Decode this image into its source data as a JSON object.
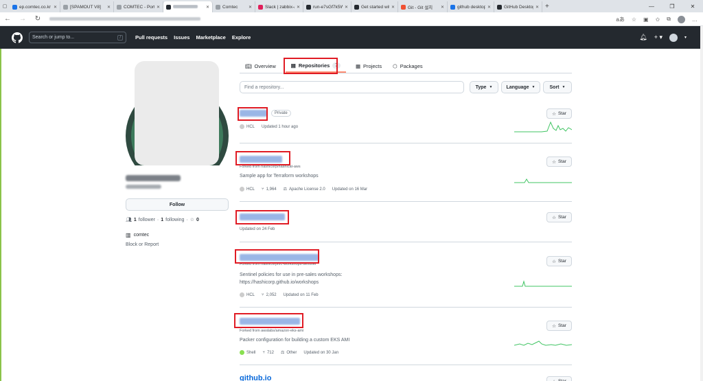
{
  "browser": {
    "tabs": [
      {
        "label": "",
        "color": "#5f6368",
        "icon": "window-icon"
      },
      {
        "label": "ep.comtec.co.kr",
        "color": "#1a73e8",
        "icon": "cloud-icon"
      },
      {
        "label": "[SPAMOUT V8]",
        "color": "#9aa0a6",
        "icon": "page-icon"
      },
      {
        "label": "COMTEC - Porta",
        "color": "#9aa0a6",
        "icon": "page-icon"
      },
      {
        "label": "",
        "color": "#24292f",
        "icon": "github-icon",
        "active": true
      },
      {
        "label": "Comtec",
        "color": "#9aa0a6",
        "icon": "page-icon"
      },
      {
        "label": "Slack | zabbix-a",
        "color": "#e01e5a",
        "icon": "slack-icon"
      },
      {
        "label": "run-e7sGf7k5W",
        "color": "#24292f",
        "icon": "fork-icon"
      },
      {
        "label": "Get started with",
        "color": "#24292f",
        "icon": "github-icon"
      },
      {
        "label": "Git - Git 설치",
        "color": "#f05133",
        "icon": "git-icon"
      },
      {
        "label": "github desktop",
        "color": "#1a73e8",
        "icon": "bing-icon"
      },
      {
        "label": "GitHub Desktop",
        "color": "#24292f",
        "icon": "github-icon"
      }
    ],
    "reader_label": "aあ"
  },
  "github": {
    "search_placeholder": "Search or jump to...",
    "search_key": "/",
    "nav": [
      "Pull requests",
      "Issues",
      "Marketplace",
      "Explore"
    ],
    "new_label": "+"
  },
  "profile": {
    "follow_label": "Follow",
    "followers_count": "1",
    "followers_label": "follower",
    "following_count": "1",
    "following_label": "following",
    "stars_count": "0",
    "org": "comtec",
    "block_label": "Block or Report"
  },
  "tabs": [
    {
      "label": "Overview",
      "icon": "book-icon"
    },
    {
      "label": "Repositories",
      "icon": "repo-icon",
      "count": "7",
      "selected": true
    },
    {
      "label": "Projects",
      "icon": "project-icon"
    },
    {
      "label": "Packages",
      "icon": "package-icon"
    }
  ],
  "filters": {
    "search_placeholder": "Find a repository...",
    "type_label": "Type",
    "language_label": "Language",
    "sort_label": "Sort"
  },
  "star_label": "Star",
  "repos": [
    {
      "badge": "Private",
      "forked": "",
      "description": "",
      "language": "HCL",
      "lang_color": "#cccccc",
      "forks": "",
      "license": "",
      "updated": "Updated 1 hour ago"
    },
    {
      "badge": "",
      "forked": "Forked from hashicorp/hashicat-aws",
      "description": "Sample app for Terraform workshops",
      "language": "HCL",
      "lang_color": "#cccccc",
      "forks": "1,964",
      "license": "Apache License 2.0",
      "updated": "Updated on 16 Mar"
    },
    {
      "badge": "",
      "forked": "",
      "description": "",
      "language": "",
      "lang_color": "",
      "forks": "",
      "license": "",
      "updated": "Updated on 24 Feb"
    },
    {
      "badge": "",
      "forked": "Forked from hashicorp/tfc-workshops-sentinel",
      "description": "Sentinel policies for use in pre-sales workshops:",
      "description2": "https://hashicorp.github.io/workshops",
      "language": "HCL",
      "lang_color": "#cccccc",
      "forks": "2,052",
      "license": "",
      "updated": "Updated on 11 Feb"
    },
    {
      "badge": "",
      "forked": "Forked from awslabs/amazon-eks-ami",
      "description": "Packer configuration for building a custom EKS AMI",
      "language": "Shell",
      "lang_color": "#89e051",
      "forks": "712",
      "license": "Other",
      "updated": "Updated on 30 Jan"
    }
  ],
  "next_repo": "github.io",
  "colors": {
    "highlight": "#e01b24",
    "spark": "#40c463",
    "header": "#24292f"
  }
}
